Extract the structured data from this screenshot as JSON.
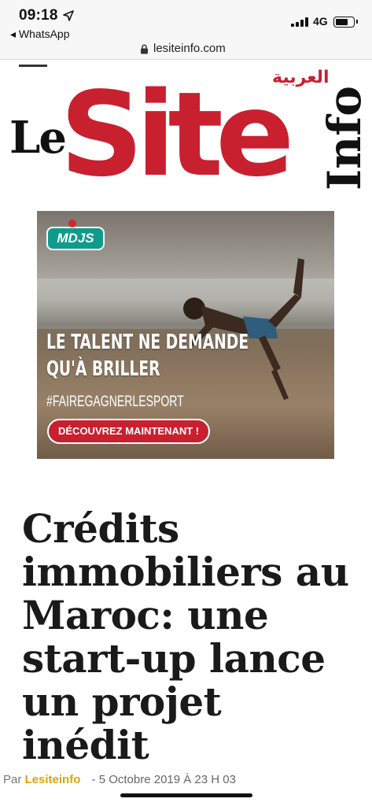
{
  "status_bar": {
    "time": "09:18",
    "back_app": "◂ WhatsApp",
    "network": "4G",
    "battery_level": 0.75,
    "icons": [
      "location-arrow-icon",
      "signal-bars-icon",
      "battery-icon"
    ]
  },
  "browser": {
    "url": "lesiteinfo.com",
    "lock_icon": "lock-icon"
  },
  "logo": {
    "le": "Le",
    "site": "Site",
    "info": "Info",
    "arabic": "العربية",
    "brand_color": "#c8202f"
  },
  "ad": {
    "brand": "MDJS",
    "headline_line1": "LE TALENT NE DEMANDE",
    "headline_line2": "QU'À BRILLER",
    "hashtag": "#FAIREGAGNERLESPORT",
    "cta": "DÉCOUVREZ MAINTENANT !"
  },
  "article": {
    "title": "Crédits immobiliers au Maroc: une start-up lance un projet inédit",
    "by_prefix": "Par",
    "author": "Lesiteinfo",
    "date": "- 5 Octobre 2019 À 23 H 03",
    "author_color": "#e0a400"
  }
}
